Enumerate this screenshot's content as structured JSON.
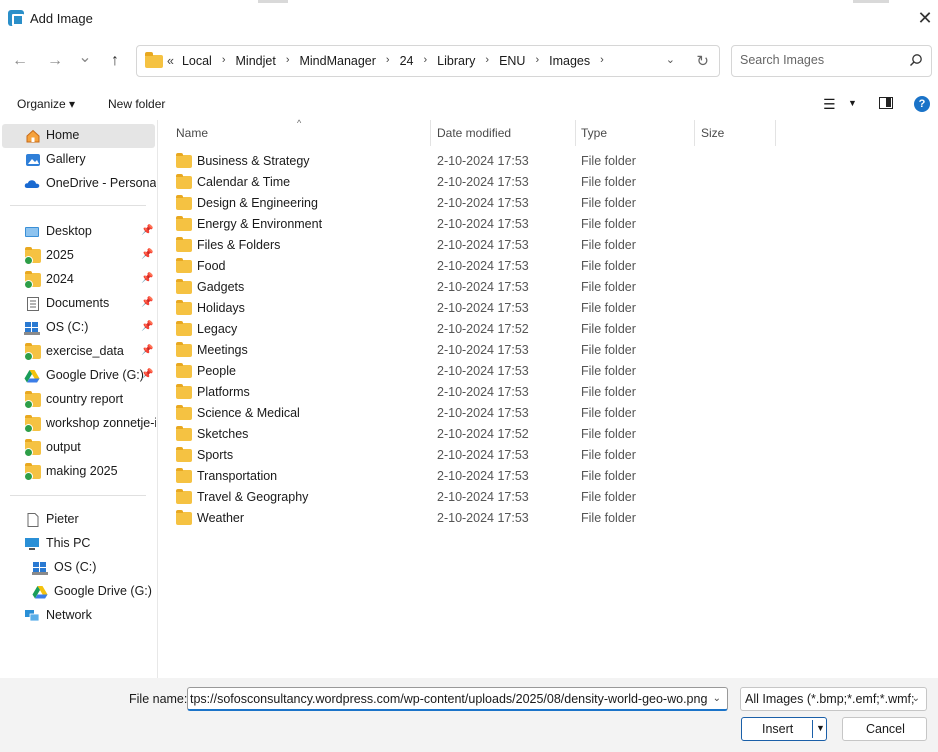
{
  "window": {
    "title": "Add Image",
    "close_glyph": "✕"
  },
  "nav": {
    "back_glyph": "←",
    "forward_glyph": "→",
    "recent_glyph": "⌄",
    "up_glyph": "↑",
    "breadcrumb_lead": "«",
    "breadcrumb": [
      "Local",
      "Mindjet",
      "MindManager",
      "24",
      "Library",
      "ENU",
      "Images"
    ],
    "breadcrumb_sep": "›",
    "refresh_glyph": "↻",
    "search_placeholder": "Search Images"
  },
  "toolbar": {
    "organize_label": "Organize ▾",
    "new_folder_label": "New folder",
    "view_glyph": "☰",
    "view_dd_glyph": "▼",
    "help_glyph": "?"
  },
  "sidebar": {
    "quick": [
      {
        "label": "Home",
        "icon": "home-icon",
        "selected": true
      },
      {
        "label": "Gallery",
        "icon": "gallery-icon"
      },
      {
        "label": "OneDrive - Personal",
        "icon": "cloud-icon"
      }
    ],
    "pinned": [
      {
        "label": "Desktop",
        "icon": "desktop-icon",
        "pinned": true
      },
      {
        "label": "2025",
        "icon": "folder-icon",
        "pinned": true
      },
      {
        "label": "2024",
        "icon": "folder-icon",
        "pinned": true
      },
      {
        "label": "Documents",
        "icon": "documents-icon",
        "pinned": true
      },
      {
        "label": "OS (C:)",
        "icon": "drive-icon",
        "pinned": true
      },
      {
        "label": "exercise_data",
        "icon": "folder-icon",
        "pinned": true
      },
      {
        "label": "Google Drive (G:)",
        "icon": "google-drive-icon",
        "pinned": true
      },
      {
        "label": "country report",
        "icon": "folder-icon"
      },
      {
        "label": "workshop zonnetje-i",
        "icon": "folder-icon"
      },
      {
        "label": "output",
        "icon": "folder-icon"
      },
      {
        "label": "making 2025",
        "icon": "folder-icon"
      }
    ],
    "pin_glyph": "📌",
    "tree": [
      {
        "label": "Pieter",
        "icon": "user-folder-icon",
        "indent": 0
      },
      {
        "label": "This PC",
        "icon": "pc-icon",
        "indent": 0
      },
      {
        "label": "OS (C:)",
        "icon": "drive-icon",
        "indent": 1
      },
      {
        "label": "Google Drive (G:)",
        "icon": "google-drive-icon",
        "indent": 1
      },
      {
        "label": "Network",
        "icon": "network-icon",
        "indent": 0
      }
    ]
  },
  "columns": {
    "name": "Name",
    "date": "Date modified",
    "type": "Type",
    "size": "Size",
    "sort_glyph": "^"
  },
  "files": [
    {
      "name": "Business & Strategy",
      "date": "2-10-2024 17:53",
      "type": "File folder"
    },
    {
      "name": "Calendar & Time",
      "date": "2-10-2024 17:53",
      "type": "File folder"
    },
    {
      "name": "Design & Engineering",
      "date": "2-10-2024 17:53",
      "type": "File folder"
    },
    {
      "name": "Energy & Environment",
      "date": "2-10-2024 17:53",
      "type": "File folder"
    },
    {
      "name": "Files & Folders",
      "date": "2-10-2024 17:53",
      "type": "File folder"
    },
    {
      "name": "Food",
      "date": "2-10-2024 17:53",
      "type": "File folder"
    },
    {
      "name": "Gadgets",
      "date": "2-10-2024 17:53",
      "type": "File folder"
    },
    {
      "name": "Holidays",
      "date": "2-10-2024 17:53",
      "type": "File folder"
    },
    {
      "name": "Legacy",
      "date": "2-10-2024 17:52",
      "type": "File folder"
    },
    {
      "name": "Meetings",
      "date": "2-10-2024 17:53",
      "type": "File folder"
    },
    {
      "name": "People",
      "date": "2-10-2024 17:53",
      "type": "File folder"
    },
    {
      "name": "Platforms",
      "date": "2-10-2024 17:53",
      "type": "File folder"
    },
    {
      "name": "Science & Medical",
      "date": "2-10-2024 17:53",
      "type": "File folder"
    },
    {
      "name": "Sketches",
      "date": "2-10-2024 17:52",
      "type": "File folder"
    },
    {
      "name": "Sports",
      "date": "2-10-2024 17:53",
      "type": "File folder"
    },
    {
      "name": "Transportation",
      "date": "2-10-2024 17:53",
      "type": "File folder"
    },
    {
      "name": "Travel & Geography",
      "date": "2-10-2024 17:53",
      "type": "File folder"
    },
    {
      "name": "Weather",
      "date": "2-10-2024 17:53",
      "type": "File folder"
    }
  ],
  "footer": {
    "filename_label": "File name:",
    "filename_value": "tps://sofosconsultancy.wordpress.com/wp-content/uploads/2025/08/density-world-geo-wo.png",
    "filter_value": "All Images (*.bmp;*.emf;*.wmf;",
    "dd_glyph": "⌄",
    "insert_label": "Insert",
    "insert_split_glyph": "▼",
    "cancel_label": "Cancel"
  },
  "colors": {
    "accent": "#1a73c8",
    "folder": "#f5c242",
    "selected_bg": "#e5e5e5",
    "footer_bg": "#f3f3f3"
  }
}
